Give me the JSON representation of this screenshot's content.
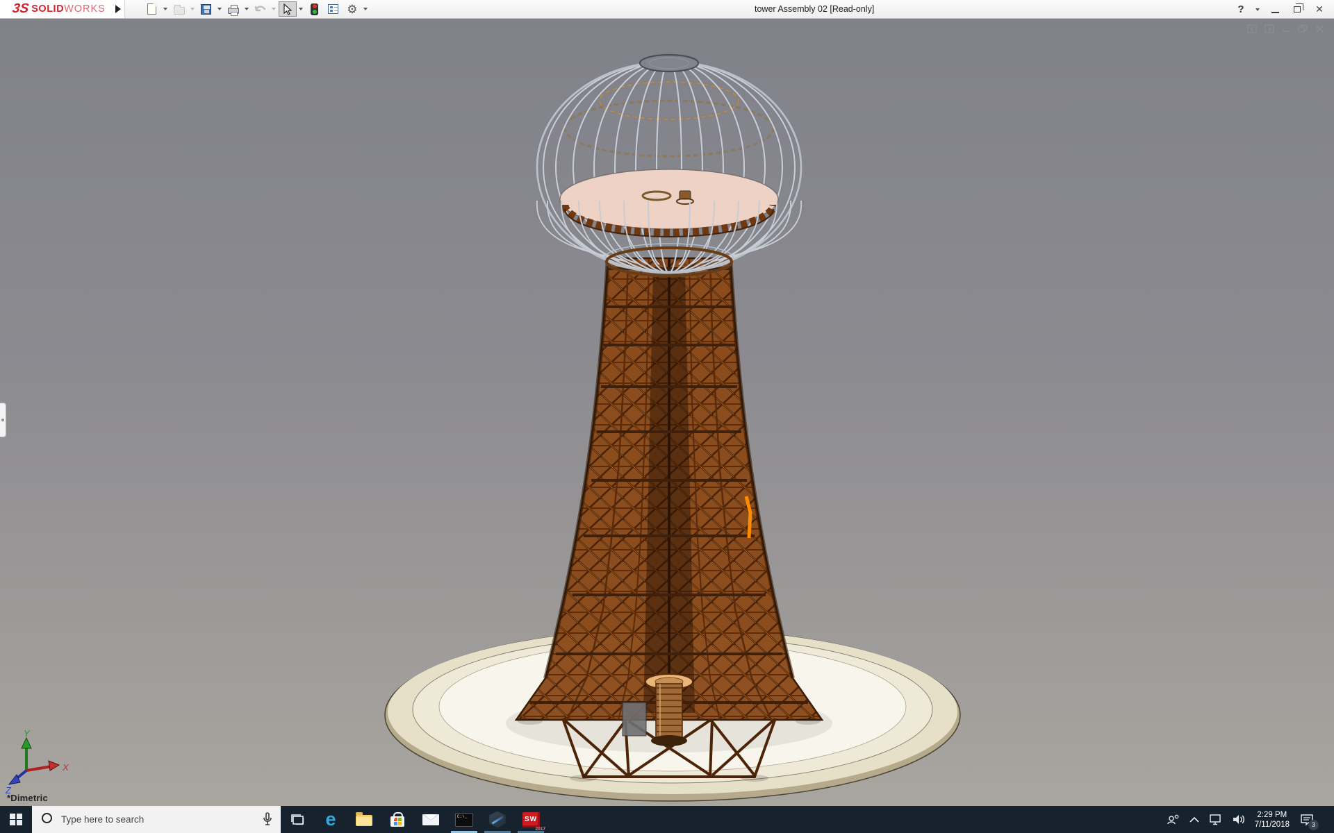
{
  "titlebar": {
    "logo_mark": "3S",
    "logo_solid": "SOLID",
    "logo_works": "WORKS",
    "title": "tower Assembly 02 [Read-only]"
  },
  "icons": {
    "help": "?",
    "close": "✕",
    "child_close": "✕",
    "gear": "⚙"
  },
  "toolbar": {
    "buttons": [
      "new",
      "open",
      "save",
      "print",
      "undo",
      "select",
      "selection-filter",
      "display-pane",
      "options"
    ],
    "disabled_buttons": [
      "open",
      "undo"
    ],
    "pressed_button": "select"
  },
  "viewport": {
    "view_label": "*Dimetric",
    "triad": {
      "x": "X",
      "y": "Y",
      "z": "Z"
    },
    "background_top": "#81818a",
    "background_bottom": "#a9a59f",
    "highlight_color": "#ff8c00",
    "model": {
      "description": "Wardenclyffe-style wooden lattice tower with hemispherical wireframe dome, pink equatorial deck and circular white platform",
      "tower_color": "#8a4a18",
      "dome_rib_color": "#c8ccd5",
      "dome_disc_color": "#eed2c6",
      "platform_color": "#f8f5ec"
    }
  },
  "taskbar": {
    "search_placeholder": "Type here to search",
    "edge_letter": "e",
    "cmd_label": "C:\\_",
    "solidworks_label": "SW",
    "solidworks_year": "2017",
    "apps": [
      "task-view",
      "edge",
      "file-explorer",
      "store",
      "mail",
      "command-prompt",
      "hexagon-app",
      "solidworks-2017"
    ],
    "running_apps": [
      "command-prompt",
      "hexagon-app",
      "solidworks-2017"
    ],
    "tray": {
      "time": "2:29 PM",
      "date": "7/11/2018",
      "notification_count": "3"
    }
  }
}
